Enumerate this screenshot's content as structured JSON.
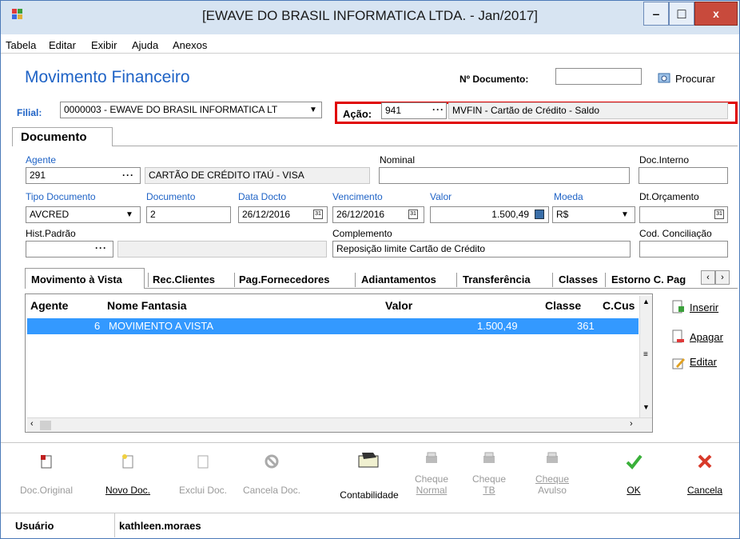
{
  "window": {
    "title": "[EWAVE DO BRASIL INFORMATICA LTDA. - Jan/2017]",
    "min": "‒",
    "max": "□",
    "close": "x"
  },
  "menu": [
    "Tabela",
    "Editar",
    "Exibir",
    "Ajuda",
    "Anexos"
  ],
  "header": {
    "title": "Movimento Financeiro",
    "num_doc_label": "Nº Documento:",
    "num_doc_value": "",
    "procurar": "Procurar"
  },
  "filial": {
    "label": "Filial:",
    "value": "0000003 - EWAVE DO BRASIL INFORMATICA LT"
  },
  "acao": {
    "label": "Ação:",
    "code": "941",
    "desc": "MVFIN - Cartão de Crédito - Saldo"
  },
  "section": {
    "tab": "Documento"
  },
  "form": {
    "agente_label": "Agente",
    "agente_code": "291",
    "agente_name": "CARTÃO DE CRÉDITO ITAÚ - VISA",
    "nominal_label": "Nominal",
    "nominal_value": "",
    "doc_interno_label": "Doc.Interno",
    "doc_interno_value": "",
    "tipo_doc_label": "Tipo Documento",
    "tipo_doc_value": "AVCRED",
    "documento_label": "Documento",
    "documento_value": "2",
    "data_docto_label": "Data Docto",
    "data_docto_value": "26/12/2016",
    "vencimento_label": "Vencimento",
    "vencimento_value": "26/12/2016",
    "valor_label": "Valor",
    "valor_value": "1.500,49",
    "moeda_label": "Moeda",
    "moeda_value": "R$",
    "dt_orcamento_label": "Dt.Orçamento",
    "dt_orcamento_value": "",
    "hist_padrao_label": "Hist.Padrão",
    "hist_padrao_value": "",
    "complemento_label": "Complemento",
    "complemento_value": "Reposição limite Cartão de Crédito",
    "cod_conciliacao_label": "Cod. Conciliação",
    "cod_conciliacao_value": ""
  },
  "tabs": [
    "Movimento à Vista",
    "Rec.Clientes",
    "Pag.Fornecedores",
    "Adiantamentos",
    "Transferência",
    "Classes",
    "Estorno C. Pag"
  ],
  "grid": {
    "headers": [
      "Agente",
      "Nome Fantasia",
      "Valor",
      "Classe",
      "C.Cus"
    ],
    "rows": [
      [
        "6",
        "MOVIMENTO A VISTA",
        "1.500,49",
        "361",
        ""
      ]
    ]
  },
  "side_buttons": [
    "Inserir",
    "Apagar",
    "Editar"
  ],
  "toolbar": {
    "doc_original": "Doc.Original",
    "novo_doc": "Novo Doc.",
    "exclui_doc": "Exclui Doc.",
    "cancela_doc": "Cancela Doc.",
    "contabilidade": "Contabilidade",
    "cheque_normal_1": "Cheque",
    "cheque_normal_2": "Normal",
    "cheque_tb_1": "Cheque",
    "cheque_tb_2": "TB",
    "cheque_avulso_1": "Cheque",
    "cheque_avulso_2": "Avulso",
    "ok": "OK",
    "cancela": "Cancela"
  },
  "status": {
    "label": "Usuário",
    "value": "kathleen.moraes"
  },
  "colors": {
    "accent": "#1f63c6",
    "selection": "#3399ff",
    "highlight": "#e00000"
  }
}
